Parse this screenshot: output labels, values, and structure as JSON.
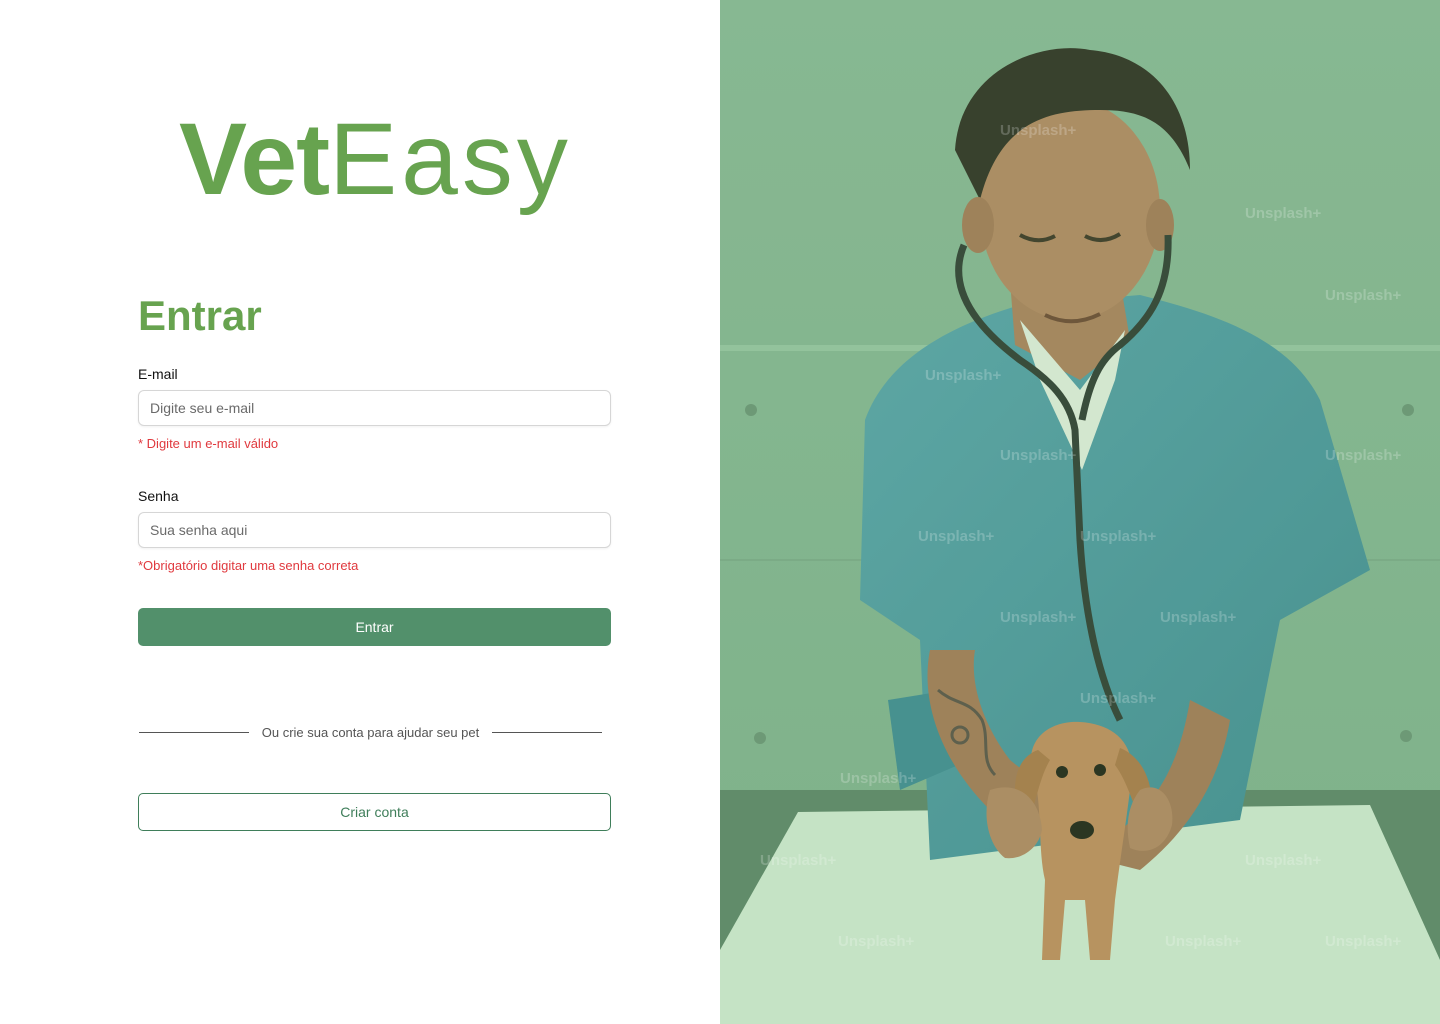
{
  "brand": {
    "name_bold": "Vet",
    "name_light": "Easy",
    "color": "#67a34f"
  },
  "login": {
    "title": "Entrar",
    "email": {
      "label": "E-mail",
      "placeholder": "Digite seu e-mail",
      "value": "",
      "error": "* Digite um e-mail válido"
    },
    "password": {
      "label": "Senha",
      "placeholder": "Sua senha aqui",
      "value": "",
      "error": "*Obrigatório digitar uma senha correta"
    },
    "submit_label": "Entrar"
  },
  "signup": {
    "divider_text": "Ou crie sua conta para ajudar seu pet",
    "button_label": "Criar conta"
  },
  "hero": {
    "watermark": "Unsplash+",
    "overlay_color": "#6ec86e"
  },
  "colors": {
    "primary_button": "#52906b",
    "error": "#e0393e",
    "secondary_border": "#3f7e5a"
  }
}
